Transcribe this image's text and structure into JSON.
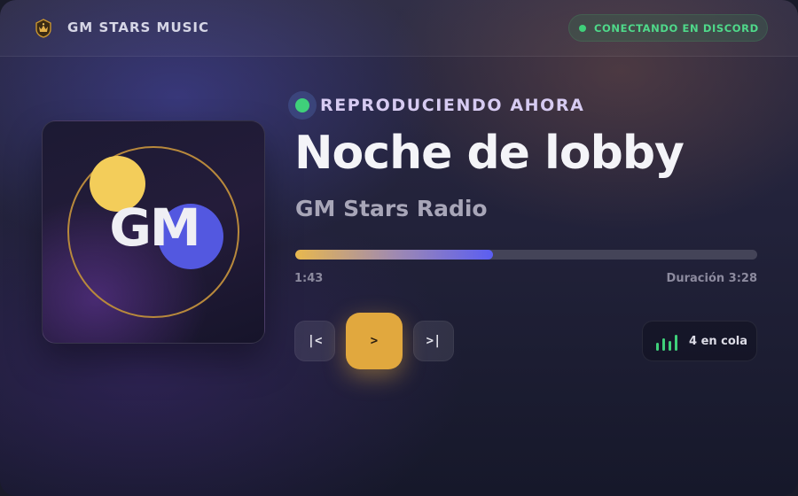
{
  "header": {
    "app_title": "GM STARS MUSIC",
    "logo_icon": "crown-badge-icon",
    "status": "CONECTANDO EN DISCORD",
    "status_color": "#3fd07a"
  },
  "cover": {
    "text": "GM",
    "accent_gold": "#f3cd5a",
    "accent_blue": "#5358e0"
  },
  "player": {
    "now_playing_label": "REPRODUCIENDO AHORA",
    "track_title": "Noche de lobby",
    "artist": "GM Stars Radio",
    "progress_fraction": 0.428,
    "time_elapsed": "1:43",
    "duration": "Duración 3:28"
  },
  "controls": {
    "prev_label": "|<",
    "play_label": ">",
    "next_label": ">|",
    "play_color": "#e1a83e"
  },
  "queue": {
    "label": "4 en cola",
    "icon": "equalizer-bars-icon",
    "icon_color": "#3fd07a"
  }
}
